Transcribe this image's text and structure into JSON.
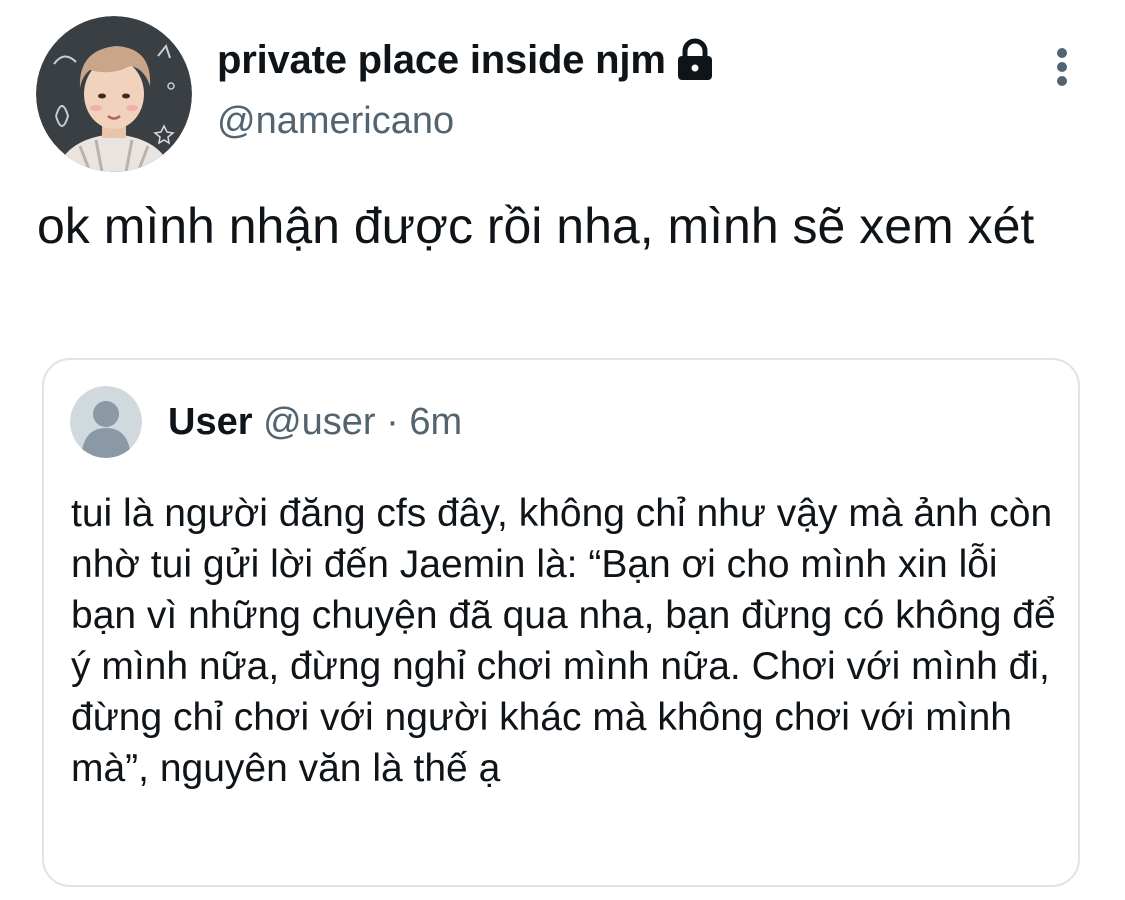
{
  "author": {
    "display_name": "private place inside njm",
    "handle": "@namericano",
    "avatar_icon": "profile-photo",
    "lock_icon": "lock-icon"
  },
  "tweet": {
    "text": "ok mình nhận được rồi nha, mình sẽ xem xét"
  },
  "more_icon": "more-vertical-icon",
  "quoted": {
    "display_name": "User",
    "handle": "@user",
    "separator": "·",
    "time": "6m",
    "avatar_icon": "default-user-icon",
    "text": "tui là người đăng cfs đây, không chỉ như vậy mà ảnh còn nhờ tui gửi lời đến Jaemin là: “Bạn ơi cho mình xin lỗi bạn vì những chuyện đã qua nha, bạn đừng có không để ý mình nữa, đừng nghỉ chơi mình nữa. Chơi với mình đi, đừng chỉ chơi với người khác mà không chơi với mình mà”, nguyên văn là thế ạ"
  },
  "colors": {
    "text_primary": "#0f1419",
    "text_secondary": "#536471",
    "card_border": "#dfe3e6",
    "default_avatar_bg": "#cfd9de",
    "default_avatar_fg": "#8b98a5"
  }
}
